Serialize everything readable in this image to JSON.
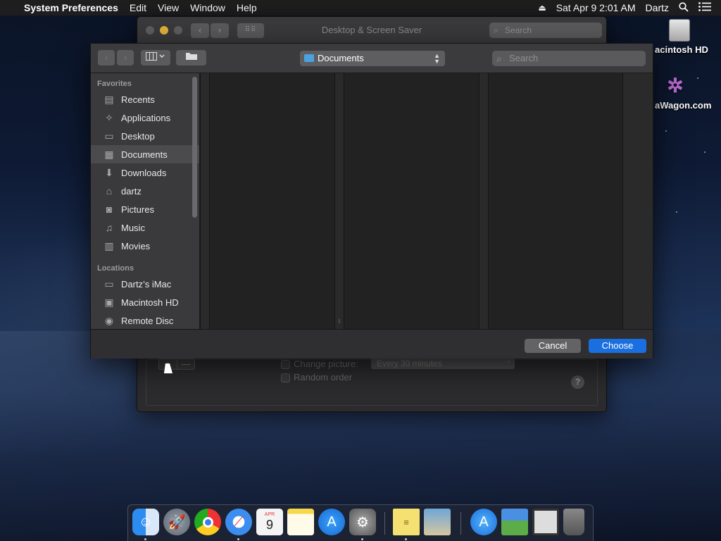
{
  "menubar": {
    "apple": "",
    "app_name": "System Preferences",
    "items": [
      "Edit",
      "View",
      "Window",
      "Help"
    ],
    "datetime": "Sat Apr 9  2:01 AM",
    "user": "Dartz"
  },
  "desktop_icons": [
    {
      "label": "acintosh HD",
      "icon": "hard-drive-icon"
    },
    {
      "label": "aWagon.com",
      "icon": "star-logo-icon"
    }
  ],
  "pref_window": {
    "title": "Desktop & Screen Saver",
    "search_placeholder": "Search",
    "change_picture_label": "Change picture:",
    "interval_value": "Every 30 minutes",
    "random_order_label": "Random order",
    "add_label": "+",
    "remove_label": "—",
    "help_label": "?"
  },
  "open_panel": {
    "current_folder": "Documents",
    "search_placeholder": "Search",
    "sidebar": {
      "favorites_header": "Favorites",
      "favorites": [
        {
          "label": "Recents",
          "icon": "clock-icon"
        },
        {
          "label": "Applications",
          "icon": "applications-icon"
        },
        {
          "label": "Desktop",
          "icon": "desktop-icon"
        },
        {
          "label": "Documents",
          "icon": "documents-icon",
          "selected": true
        },
        {
          "label": "Downloads",
          "icon": "download-icon"
        },
        {
          "label": "dartz",
          "icon": "home-icon"
        },
        {
          "label": "Pictures",
          "icon": "camera-icon"
        },
        {
          "label": "Music",
          "icon": "music-note-icon"
        },
        {
          "label": "Movies",
          "icon": "film-icon"
        }
      ],
      "locations_header": "Locations",
      "locations": [
        {
          "label": "Dartz’s iMac",
          "icon": "imac-icon"
        },
        {
          "label": "Macintosh HD",
          "icon": "hard-drive-icon"
        },
        {
          "label": "Remote Disc",
          "icon": "disc-icon"
        }
      ]
    },
    "cancel_label": "Cancel",
    "choose_label": "Choose"
  },
  "dock": {
    "apps": [
      "finder-icon",
      "launchpad-icon",
      "chrome-icon",
      "safari-icon",
      "calendar-icon",
      "notes-icon",
      "app-store-icon",
      "system-preferences-icon",
      "stickies-icon",
      "preview-icon",
      "app-store-folder-icon",
      "desktop-image-icon",
      "screen-icon",
      "trash-icon"
    ],
    "calendar_month": "APR",
    "calendar_day": "9"
  },
  "colors": {
    "accent": "#1a6fe0",
    "selected_row": "#4b4b4d"
  }
}
